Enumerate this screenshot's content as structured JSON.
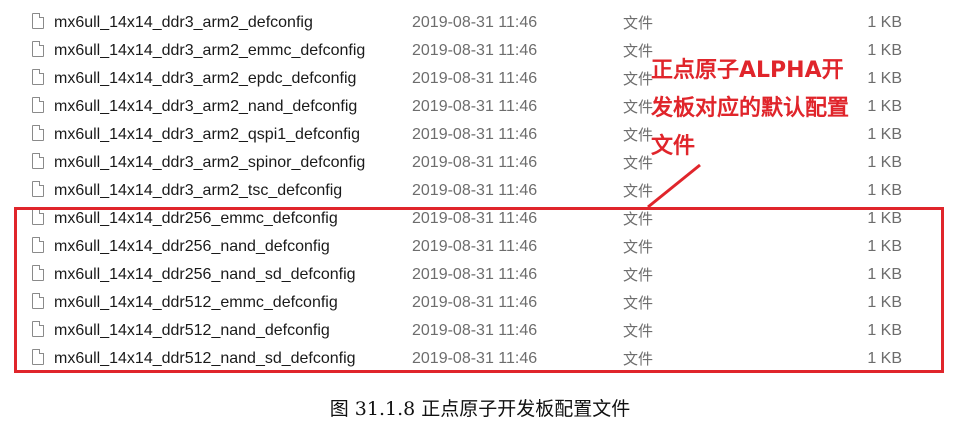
{
  "files": [
    {
      "name": "mx6ull_14x14_ddr3_arm2_defconfig",
      "date": "2019-08-31 11:46",
      "type": "文件",
      "size": "1 KB"
    },
    {
      "name": "mx6ull_14x14_ddr3_arm2_emmc_defconfig",
      "date": "2019-08-31 11:46",
      "type": "文件",
      "size": "1 KB"
    },
    {
      "name": "mx6ull_14x14_ddr3_arm2_epdc_defconfig",
      "date": "2019-08-31 11:46",
      "type": "文件",
      "size": "1 KB"
    },
    {
      "name": "mx6ull_14x14_ddr3_arm2_nand_defconfig",
      "date": "2019-08-31 11:46",
      "type": "文件",
      "size": "1 KB"
    },
    {
      "name": "mx6ull_14x14_ddr3_arm2_qspi1_defconfig",
      "date": "2019-08-31 11:46",
      "type": "文件",
      "size": "1 KB"
    },
    {
      "name": "mx6ull_14x14_ddr3_arm2_spinor_defconfig",
      "date": "2019-08-31 11:46",
      "type": "文件",
      "size": "1 KB"
    },
    {
      "name": "mx6ull_14x14_ddr3_arm2_tsc_defconfig",
      "date": "2019-08-31 11:46",
      "type": "文件",
      "size": "1 KB"
    },
    {
      "name": "mx6ull_14x14_ddr256_emmc_defconfig",
      "date": "2019-08-31 11:46",
      "type": "文件",
      "size": "1 KB"
    },
    {
      "name": "mx6ull_14x14_ddr256_nand_defconfig",
      "date": "2019-08-31 11:46",
      "type": "文件",
      "size": "1 KB"
    },
    {
      "name": "mx6ull_14x14_ddr256_nand_sd_defconfig",
      "date": "2019-08-31 11:46",
      "type": "文件",
      "size": "1 KB"
    },
    {
      "name": "mx6ull_14x14_ddr512_emmc_defconfig",
      "date": "2019-08-31 11:46",
      "type": "文件",
      "size": "1 KB"
    },
    {
      "name": "mx6ull_14x14_ddr512_nand_defconfig",
      "date": "2019-08-31 11:46",
      "type": "文件",
      "size": "1 KB"
    },
    {
      "name": "mx6ull_14x14_ddr512_nand_sd_defconfig",
      "date": "2019-08-31 11:46",
      "type": "文件",
      "size": "1 KB"
    }
  ],
  "annotation": {
    "lines": [
      "正点原子ALPHA开",
      "发板对应的默认配置",
      "文件"
    ],
    "color": "#e0252b"
  },
  "caption": "图 31.1.8 正点原子开发板配置文件"
}
